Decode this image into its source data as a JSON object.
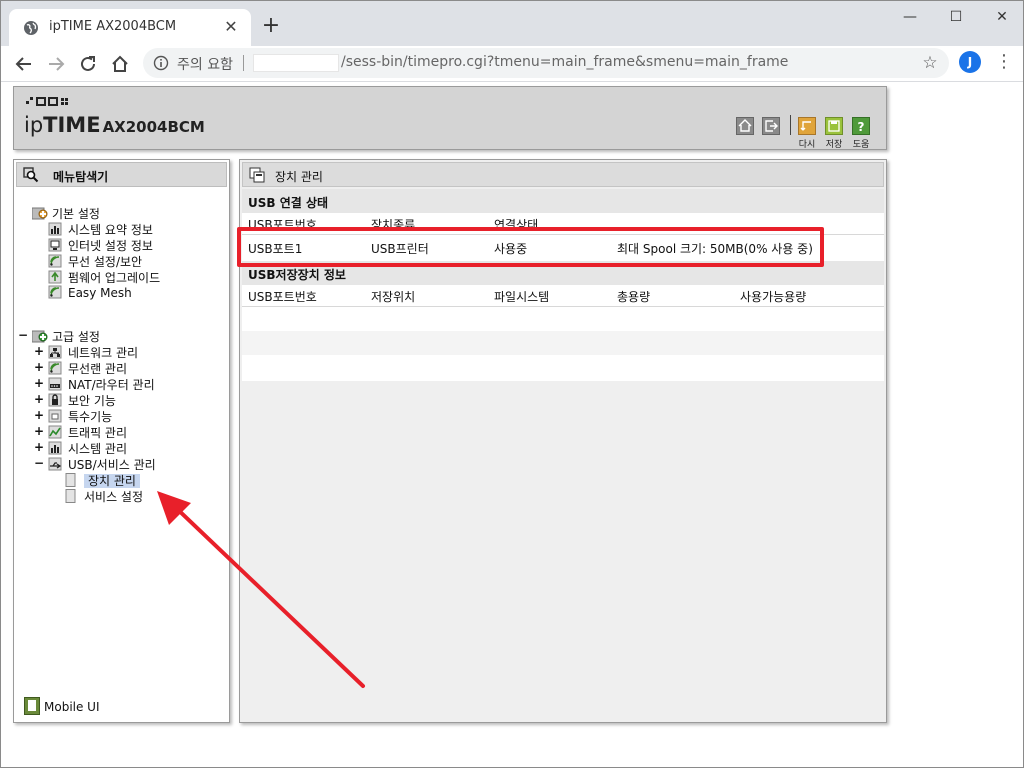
{
  "browser": {
    "tab_title": "ipTIME AX2004BCM",
    "tab_close": "✕",
    "new_tab": "+",
    "window_minimize": "—",
    "window_maximize": "☐",
    "window_close": "✕",
    "security_label": "주의 요함",
    "url": "/sess-bin/timepro.cgi?tmenu=main_frame&smenu=main_frame",
    "avatar_letter": "J",
    "menu_dots": "⋮",
    "star": "☆"
  },
  "header": {
    "logo_ip": "ip",
    "logo_time": "TIME",
    "model": "AX2004BCM",
    "icons": [
      {
        "name": "home-icon",
        "label": ""
      },
      {
        "name": "logout-icon",
        "label": ""
      },
      {
        "name": "reload-icon",
        "label": "다시"
      },
      {
        "name": "save-icon",
        "label": "저장"
      },
      {
        "name": "help-icon",
        "label": "도움"
      }
    ]
  },
  "menu": {
    "title": "메뉴탐색기",
    "basic_group": "기본 설정",
    "basic_items": [
      "시스템 요약 정보",
      "인터넷 설정 정보",
      "무선 설정/보안",
      "펌웨어 업그레이드",
      "Easy Mesh"
    ],
    "advanced_group": "고급 설정",
    "advanced_items": [
      "네트워크 관리",
      "무선랜 관리",
      "NAT/라우터 관리",
      "보안 기능",
      "특수기능",
      "트래픽 관리",
      "시스템 관리",
      "USB/서비스 관리"
    ],
    "usb_sub_items": [
      "장치 관리",
      "서비스 설정"
    ],
    "mobile_ui": "Mobile UI",
    "expander_plus": "+",
    "expander_minus": "−"
  },
  "content": {
    "title": "장치 관리",
    "usb_status": {
      "section_title": "USB 연결 상태",
      "headers": [
        "USB포트번호",
        "장치종류",
        "연결상태"
      ],
      "row": [
        "USB포트1",
        "USB프린터",
        "사용중",
        "최대 Spool 크기: 50MB(0% 사용 중)"
      ]
    },
    "storage": {
      "section_title": "USB저장장치 정보",
      "headers": [
        "USB포트번호",
        "저장위치",
        "파일시스템",
        "총용량",
        "사용가능용량"
      ]
    }
  },
  "colors": {
    "highlight": "#e8202a",
    "selected_bg": "#c6d6ef"
  }
}
